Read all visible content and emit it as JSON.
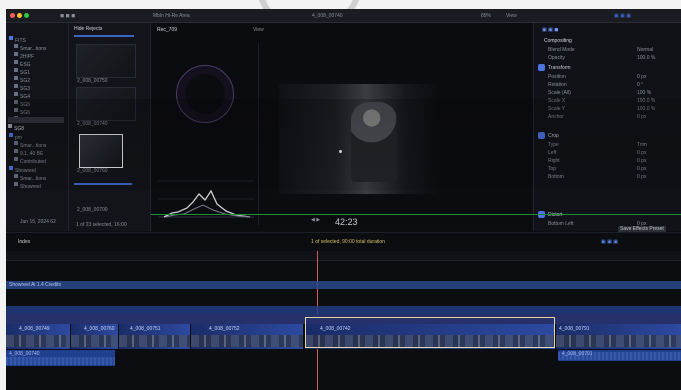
{
  "app": {
    "browser_header": "Hide Rejects",
    "viewer_title": "Rec_709",
    "top_title": "Mbln Hi-Re Area",
    "viewer_clip": "4_008_00740",
    "zoom": "89%",
    "view_label": "View",
    "timecode": "42:23",
    "index_label": "Index",
    "selection_info": "1 of selected, 90:00 total duration",
    "status_left": "1 of 23 selected, 16:00",
    "date_item": "Jun 15, 2024 62",
    "inspector_header": "Compositing",
    "inspector_items": [
      "Blend Mode",
      "Opacity",
      "Transform",
      "Position",
      "Rotation",
      "Scale (All)",
      "Scale X",
      "Scale Y",
      "Anchor",
      "Crop",
      "Type",
      "Left",
      "Right",
      "Top",
      "Bottom",
      "Distort",
      "Bottom Left"
    ],
    "inspector_values": [
      "Normal",
      "100.0 %",
      "",
      "0 px",
      "0 °",
      "100 %",
      "100.0 %",
      "100.0 %",
      "0 px",
      "",
      "Trim",
      "0 px",
      "0 px",
      "0 px",
      "0 px",
      "",
      "0 px"
    ],
    "save_preset": "Save Effects Preset"
  },
  "library": {
    "items": [
      "FITS",
      "Smar...tions",
      "2HIPF",
      "ESG",
      "SG1",
      "SG2",
      "SG3",
      "SG4",
      "SG5",
      "SG6",
      "SG7",
      "SG8",
      "pm",
      "Smar...tions",
      "9.1..40 BE",
      "Contributed",
      "Showreel",
      "Smar...tions",
      "Showreel"
    ]
  },
  "clips": {
    "browser": [
      "2_008_00750",
      "2_008_00740",
      "2_008_00760",
      "2_008_00700"
    ],
    "timeline_labels": [
      "4_008_00749",
      "4_008_00760",
      "4_008_00751",
      "4_008_00752",
      "4_008_00742",
      "4_008_00740",
      "4_008_00791",
      "4_008_00741"
    ],
    "storyline_label": "Showreel Ai 1.4 Credits",
    "audio_left": "4_008_00740",
    "audio_right": "4_008_00791"
  },
  "colors": {
    "playhead": "#d65a52",
    "accent_blue": "#3c67c7",
    "selection": "#e2d7a0"
  }
}
